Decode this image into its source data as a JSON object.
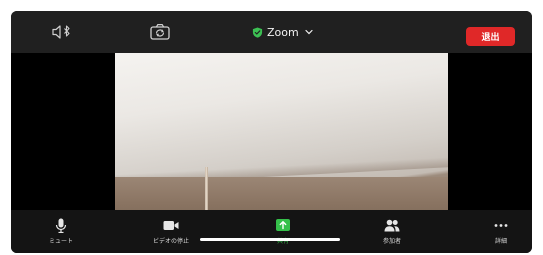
{
  "header": {
    "meeting_title": "Zoom",
    "leave_label": "退出"
  },
  "toolbar": {
    "mute_label": "ミュート",
    "stop_video_label": "ビデオの停止",
    "share_label": "共有",
    "participants_label": "参加者",
    "more_label": "詳細"
  },
  "icons": {
    "speaker": "speaker-bluetooth-icon",
    "camera_switch": "camera-switch-icon",
    "shield": "shield-check-icon",
    "dropdown": "chevron-down-icon",
    "mic": "microphone-icon",
    "video": "video-camera-icon",
    "share": "share-arrow-icon",
    "participants": "participants-icon",
    "more": "more-dots-icon"
  },
  "colors": {
    "leave_button": "#e02828",
    "share_accent": "#35c04a",
    "verified_shield": "#3cc053",
    "toolbar_bg": "#141414",
    "topbar_bg": "#202020"
  }
}
